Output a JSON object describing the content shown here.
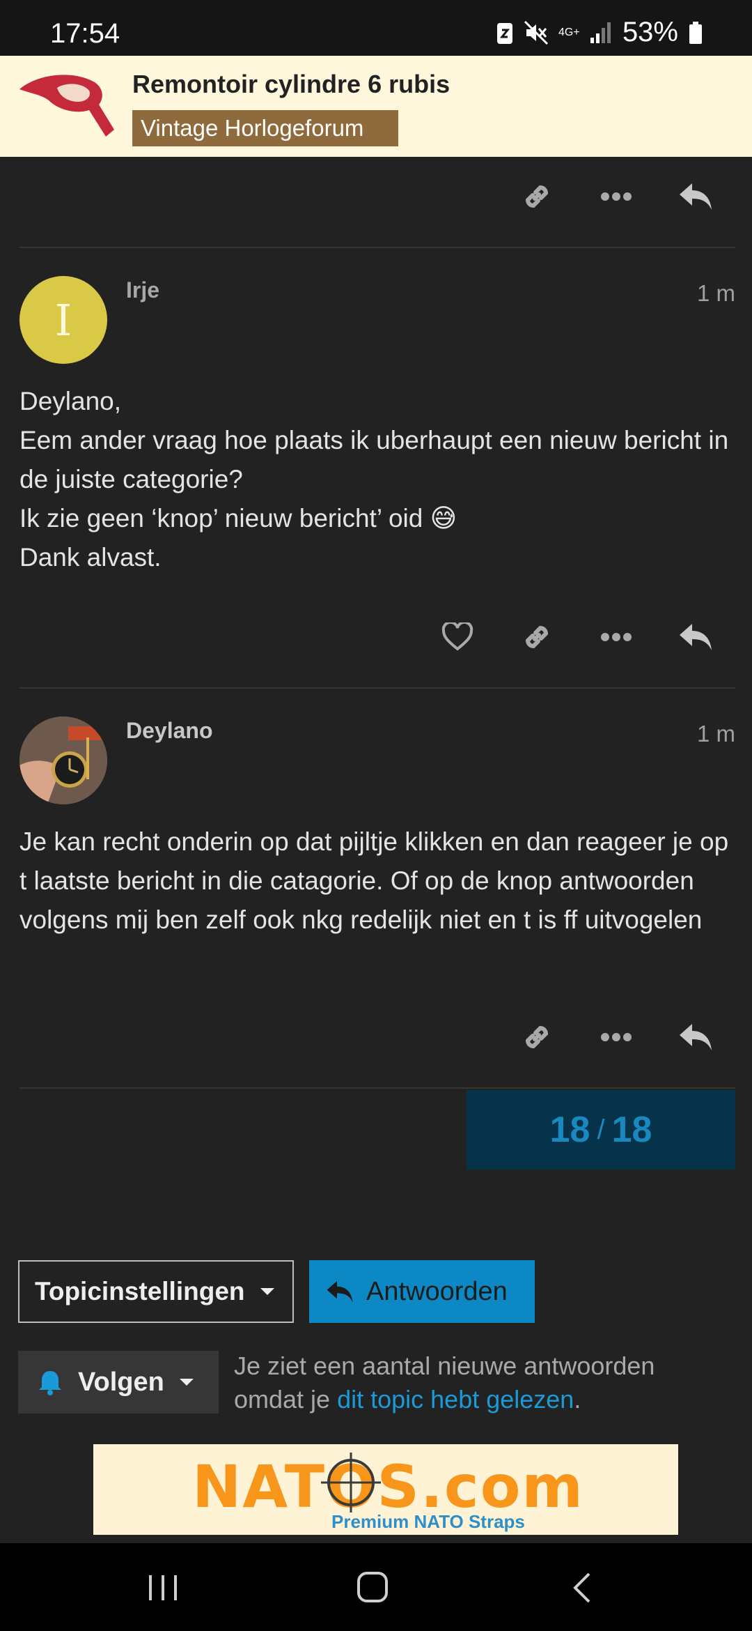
{
  "status_bar": {
    "time": "17:54",
    "network": "4G+",
    "battery": "53%"
  },
  "header": {
    "title": "Remontoir cylindre 6 rubis",
    "category": "Vintage Horlogeforum",
    "logo_icon": "forum-logo-icon"
  },
  "posts": [
    {
      "username": "Irje",
      "avatar_letter": "I",
      "avatar_color": "#d9c946",
      "time": "1 m",
      "lines": [
        "Deylano,",
        "Eem ander vraag hoe plaats ik uberhaupt een nieuw bericht in de juiste categorie?",
        "Ik zie geen ‘knop’ nieuw bericht’ oid 😅",
        "Dank alvast."
      ]
    },
    {
      "username": "Deylano",
      "time": "1 m",
      "lines": [
        "Je kan recht onderin op dat pijltje klikken en dan reageer je op t laatste bericht in die catagorie. Of op de knop antwoorden volgens mij ben zelf ook nkg redelijk niet en t is ff uitvogelen"
      ]
    }
  ],
  "progress": {
    "current": "18",
    "separator": "/",
    "total": "18"
  },
  "controls": {
    "topic_settings_label": "Topicinstellingen",
    "reply_label": "Antwoorden",
    "follow_label": "Volgen",
    "notify_text_before": "Je ziet een aantal nieuwe antwoorden omdat je ",
    "notify_link": "dit topic hebt gelezen",
    "notify_text_after": "."
  },
  "ad": {
    "title": "NATOS.com",
    "subtitle": "Premium NATO Straps"
  },
  "colors": {
    "accent": "#0c89c4",
    "background": "#222222",
    "header_bg": "#fff8dc",
    "category": "#8f6a3c"
  }
}
